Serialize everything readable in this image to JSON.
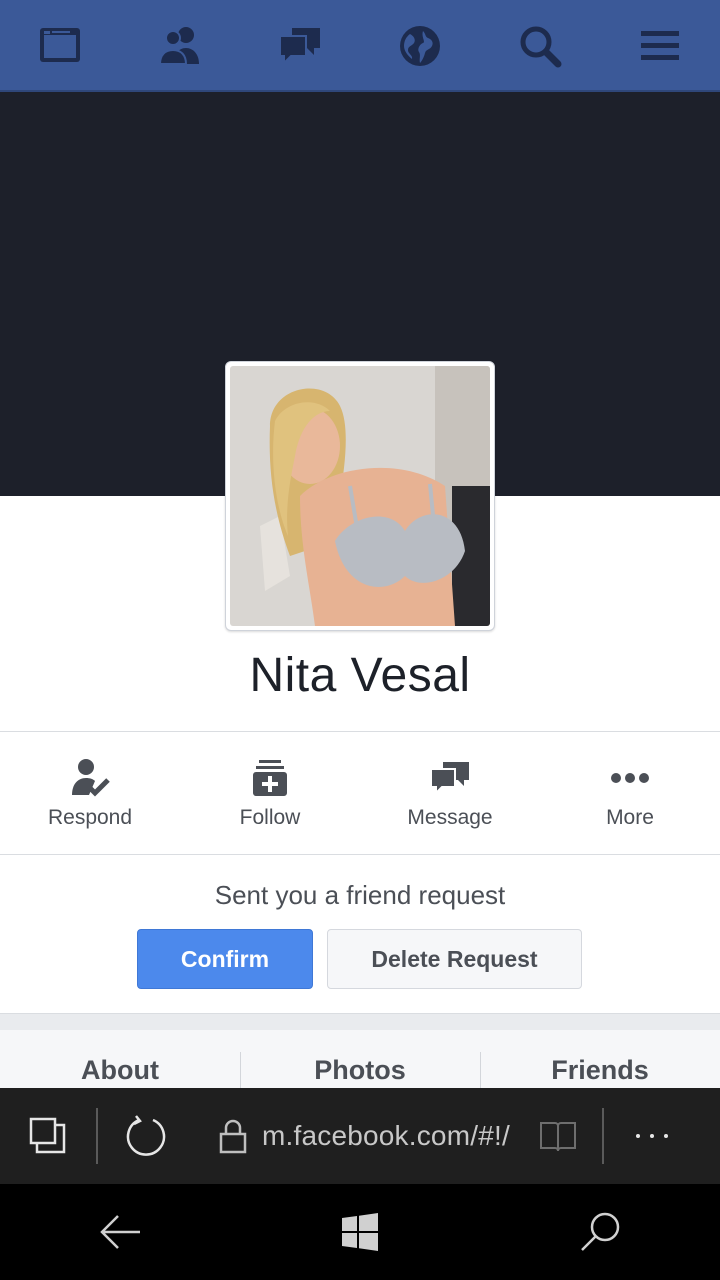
{
  "top_nav": {
    "items": [
      {
        "icon": "news-feed-icon"
      },
      {
        "icon": "friend-requests-icon"
      },
      {
        "icon": "messages-icon"
      },
      {
        "icon": "notifications-globe-icon"
      },
      {
        "icon": "search-icon"
      },
      {
        "icon": "menu-icon"
      }
    ],
    "bg_color": "#3b5998",
    "icon_color": "#1d2b4e"
  },
  "cover": {
    "bg_color": "#1d202a"
  },
  "profile": {
    "name": "Nita Vesal"
  },
  "actions": [
    {
      "label": "Respond",
      "icon": "respond-icon"
    },
    {
      "label": "Follow",
      "icon": "follow-icon"
    },
    {
      "label": "Message",
      "icon": "message-icon"
    },
    {
      "label": "More",
      "icon": "more-icon"
    }
  ],
  "friend_request": {
    "text": "Sent you a friend request",
    "confirm_label": "Confirm",
    "delete_label": "Delete Request",
    "confirm_color": "#4c89ec"
  },
  "tabs": [
    {
      "label": "About"
    },
    {
      "label": "Photos"
    },
    {
      "label": "Friends"
    }
  ],
  "browser": {
    "url": "m.facebook.com/#!/",
    "icons": [
      "tabs-icon",
      "refresh-icon",
      "lock-icon",
      "reading-view-icon",
      "more-icon"
    ]
  },
  "phone_nav": {
    "icons": [
      "back-icon",
      "windows-start-icon",
      "search-icon"
    ]
  }
}
